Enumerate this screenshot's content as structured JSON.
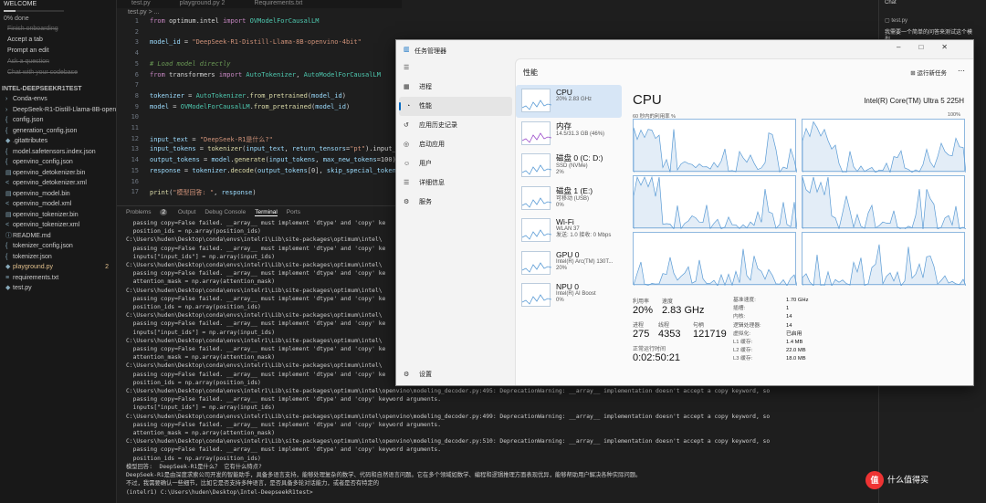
{
  "sidebar": {
    "welcome_title": "WELCOME",
    "progress_text": "0% done",
    "progress_value": 0.2,
    "walkthrough": [
      {
        "label": "Finish onboarding",
        "done": true
      },
      {
        "label": "Accept a tab",
        "done": false
      },
      {
        "label": "Prompt an edit",
        "done": false
      },
      {
        "label": "Ask a question",
        "done": true
      },
      {
        "label": "Chat with your codebase",
        "done": true
      }
    ],
    "project": "INTEL-DEEPSEEKR1TEST",
    "files": [
      {
        "name": "Conda-envs",
        "icon": "folder",
        "modified": false
      },
      {
        "name": "DeepSeek-R1-Distill-Llama-8B-open...",
        "icon": "folder",
        "modified": false
      },
      {
        "name": "config.json",
        "icon": "json",
        "modified": false
      },
      {
        "name": "generation_config.json",
        "icon": "json",
        "modified": false
      },
      {
        "name": ".gitattributes",
        "icon": "git",
        "modified": false
      },
      {
        "name": "model.safetensors.index.json",
        "icon": "json",
        "modified": false
      },
      {
        "name": "openvino_config.json",
        "icon": "json",
        "modified": false
      },
      {
        "name": "openvino_detokenizer.bin",
        "icon": "file",
        "modified": false
      },
      {
        "name": "openvino_detokenizer.xml",
        "icon": "xml",
        "modified": false
      },
      {
        "name": "openvino_model.bin",
        "icon": "file",
        "modified": false
      },
      {
        "name": "openvino_model.xml",
        "icon": "xml",
        "modified": false
      },
      {
        "name": "openvino_tokenizer.bin",
        "icon": "file",
        "modified": false
      },
      {
        "name": "openvino_tokenizer.xml",
        "icon": "xml",
        "modified": false
      },
      {
        "name": "README.md",
        "icon": "info",
        "modified": false
      },
      {
        "name": "tokenizer_config.json",
        "icon": "json",
        "modified": false
      },
      {
        "name": "tokenizer.json",
        "icon": "json",
        "modified": false
      },
      {
        "name": "playground.py",
        "icon": "py",
        "modified": true,
        "badge": "2"
      },
      {
        "name": "requirements.txt",
        "icon": "txt",
        "modified": false
      },
      {
        "name": "test.py",
        "icon": "py",
        "modified": false
      }
    ]
  },
  "editor": {
    "tabs": [
      "test.py",
      "playground.py 2",
      "Requirements.txt"
    ],
    "breadcrumb": "test.py > ...",
    "lines": [
      {
        "n": "1",
        "html": "<span class='k'>from</span> optimum.intel <span class='k'>import</span> <span class='t'>OVModelForCausalLM</span>"
      },
      {
        "n": "2",
        "html": ""
      },
      {
        "n": "3",
        "html": "<span class='v'>model_id</span> = <span class='s'>\"DeepSeek-R1-Distill-Llama-8B-openvino-4bit\"</span>"
      },
      {
        "n": "4",
        "html": ""
      },
      {
        "n": "5",
        "html": "<span class='c'># Load model directly</span>"
      },
      {
        "n": "6",
        "html": "<span class='k'>from</span> transformers <span class='k'>import</span> <span class='t'>AutoTokenizer</span>, <span class='t'>AutoModelForCausalLM</span>"
      },
      {
        "n": "7",
        "html": ""
      },
      {
        "n": "8",
        "html": "<span class='v'>tokenizer</span> = <span class='t'>AutoTokenizer</span>.<span class='f'>from_pretrained</span>(<span class='v'>model_id</span>)"
      },
      {
        "n": "9",
        "html": "<span class='v'>model</span> = <span class='t'>OVModelForCausalLM</span>.<span class='f'>from_pretrained</span>(<span class='v'>model_id</span>)"
      },
      {
        "n": "10",
        "html": ""
      },
      {
        "n": "11",
        "html": ""
      },
      {
        "n": "12",
        "html": "<span class='v'>input_text</span> = <span class='s'>\"DeepSeek-R1是什么?\"</span>"
      },
      {
        "n": "13",
        "html": "<span class='v'>input_tokens</span> = <span class='f'>tokenizer</span>(<span class='v'>input_text</span>, <span class='v'>return_tensors</span>=<span class='s'>\"pt\"</span>).input_i"
      },
      {
        "n": "14",
        "html": "<span class='v'>output_tokens</span> = <span class='v'>model</span>.<span class='f'>generate</span>(<span class='v'>input_tokens</span>, <span class='v'>max_new_tokens</span>=100)"
      },
      {
        "n": "15",
        "html": "<span class='v'>response</span> = <span class='v'>tokenizer</span>.<span class='f'>decode</span>(<span class='v'>output_tokens</span>[0], <span class='v'>skip_special_token</span>"
      },
      {
        "n": "16",
        "html": ""
      },
      {
        "n": "17",
        "html": "<span class='f'>print</span>(<span class='s'>\"模型回答: \"</span>, <span class='v'>response</span>)"
      }
    ]
  },
  "panel": {
    "tabs": [
      "Problems",
      "Output",
      "Debug Console",
      "Terminal",
      "Ports"
    ],
    "problems_count": "2",
    "active_tab": "Terminal"
  },
  "terminal": [
    "  passing copy=False failed. __array__ must implement 'dtype' and 'copy' ke",
    "  position_ids = np.array(position_ids)",
    "C:\\Users\\huden\\Desktop\\conda\\envs\\intelr1\\Lib\\site-packages\\optimum\\intel\\",
    "  passing copy=False failed. __array__ must implement 'dtype' and 'copy' ke",
    "  inputs[\"input_ids\"] = np.array(input_ids)",
    "C:\\Users\\huden\\Desktop\\conda\\envs\\intelr1\\Lib\\site-packages\\optimum\\intel\\",
    "  passing copy=False failed. __array__ must implement 'dtype' and 'copy' ke",
    "  attention_mask = np.array(attention_mask)",
    "C:\\Users\\huden\\Desktop\\conda\\envs\\intelr1\\Lib\\site-packages\\optimum\\intel\\",
    "  passing copy=False failed. __array__ must implement 'dtype' and 'copy' ke",
    "  position_ids = np.array(position_ids)",
    "C:\\Users\\huden\\Desktop\\conda\\envs\\intelr1\\Lib\\site-packages\\optimum\\intel\\",
    "  passing copy=False failed. __array__ must implement 'dtype' and 'copy' ke",
    "  inputs[\"input_ids\"] = np.array(input_ids)",
    "C:\\Users\\huden\\Desktop\\conda\\envs\\intelr1\\Lib\\site-packages\\optimum\\intel\\",
    "  passing copy=False failed. __array__ must implement 'dtype' and 'copy' ke",
    "  attention_mask = np.array(attention_mask)",
    "C:\\Users\\huden\\Desktop\\conda\\envs\\intelr1\\Lib\\site-packages\\optimum\\intel\\",
    "  passing copy=False failed. __array__ must implement 'dtype' and 'copy' ke",
    "  position_ids = np.array(position_ids)",
    "C:\\Users\\huden\\Desktop\\conda\\envs\\intelr1\\Lib\\site-packages\\optimum\\intel\\openvino\\modeling_decoder.py:495: DeprecationWarning: __array__ implementation doesn't accept a copy keyword, so",
    "  passing copy=False failed. __array__ must implement 'dtype' and 'copy' keyword arguments.",
    "  inputs[\"input_ids\"] = np.array(input_ids)",
    "C:\\Users\\huden\\Desktop\\conda\\envs\\intelr1\\Lib\\site-packages\\optimum\\intel\\openvino\\modeling_decoder.py:499: DeprecationWarning: __array__ implementation doesn't accept a copy keyword, so",
    "  passing copy=False failed. __array__ must implement 'dtype' and 'copy' keyword arguments.",
    "  attention_mask = np.array(attention_mask)",
    "C:\\Users\\huden\\Desktop\\conda\\envs\\intelr1\\Lib\\site-packages\\optimum\\intel\\openvino\\modeling_decoder.py:510: DeprecationWarning: __array__ implementation doesn't accept a copy keyword, so",
    "  passing copy=False failed. __array__ must implement 'dtype' and 'copy' keyword arguments.",
    "  position_ids = np.array(position_ids)",
    "模型回答:  DeepSeek-R1是什么？ 它有什么特点?",
    "DeepSeek-R1是由深度求索公司开发的智能助手，具备多语言支持，能够处理复杂的数学、代码和自然语言问题。它在多个领域如数学、编程和逻辑推理方面表现优异，能够帮助用户解决各种实际问题。",
    "不过，我需要确认一些细节，比如它是否支持多种语言，是否具备多轮对话能力，或者是否有特定的",
    "",
    "(intelr1) C:\\Users\\huden\\Desktop\\Intel-DeepseekR1test>"
  ],
  "taskmgr": {
    "title": "任务管理器",
    "nav": [
      {
        "label": "进程",
        "icon": "processes-icon",
        "glyph": "▦"
      },
      {
        "label": "性能",
        "icon": "performance-icon",
        "glyph": "◔",
        "selected": true
      },
      {
        "label": "应用历史记录",
        "icon": "history-icon",
        "glyph": "↺"
      },
      {
        "label": "启动应用",
        "icon": "startup-icon",
        "glyph": "◎"
      },
      {
        "label": "用户",
        "icon": "users-icon",
        "glyph": "☺"
      },
      {
        "label": "详细信息",
        "icon": "details-icon",
        "glyph": "☰"
      },
      {
        "label": "服务",
        "icon": "services-icon",
        "glyph": "⚙"
      }
    ],
    "settings": "设置",
    "header": "性能",
    "run_task": "运行新任务",
    "resources": [
      {
        "name": "CPU",
        "sub1": "20% 2.83 GHz",
        "sub2": "",
        "sub3": "",
        "selected": true
      },
      {
        "name": "内存",
        "sub1": "14.5/31.3 GB (46%)",
        "sub2": "",
        "sub3": ""
      },
      {
        "name": "磁盘 0 (C: D:)",
        "sub1": "SSD (NVMe)",
        "sub2": "2%",
        "sub3": ""
      },
      {
        "name": "磁盘 1 (E:)",
        "sub1": "可移动 (USB)",
        "sub2": "0%",
        "sub3": ""
      },
      {
        "name": "Wi-Fi",
        "sub1": "WLAN 37",
        "sub2": "发送: 1.0 接收: 0 Mbps",
        "sub3": ""
      },
      {
        "name": "GPU 0",
        "sub1": "Intel(R) Arc(TM) 130T...",
        "sub2": "20%",
        "sub3": ""
      },
      {
        "name": "NPU 0",
        "sub1": "Intel(R) AI Boost",
        "sub2": "0%",
        "sub3": ""
      }
    ],
    "cpu": {
      "title": "CPU",
      "model": "Intel(R) Core(TM) Ultra 5 225H",
      "graph_caption": "60 秒内的利用率 %",
      "graph_max": "100%",
      "utilization_label": "利用率",
      "utilization": "20%",
      "speed_label": "速度",
      "speed": "2.83 GHz",
      "processes_label": "进程",
      "processes": "275",
      "threads_label": "线程",
      "threads": "4353",
      "handles_label": "句柄",
      "handles": "121719",
      "uptime_label": "正常运行时间",
      "uptime": "0:02:50:21",
      "specs": [
        {
          "k": "基准速度:",
          "v": "1.70 GHz"
        },
        {
          "k": "插槽:",
          "v": "1"
        },
        {
          "k": "内核:",
          "v": "14"
        },
        {
          "k": "逻辑处理器:",
          "v": "14"
        },
        {
          "k": "虚拟化:",
          "v": "已启用"
        },
        {
          "k": "L1 缓存:",
          "v": "1.4 MB"
        },
        {
          "k": "L2 缓存:",
          "v": "22.0 MB"
        },
        {
          "k": "L3 缓存:",
          "v": "18.0 MB"
        }
      ]
    }
  },
  "chat": {
    "title": "Chat",
    "file": "test.py",
    "question": "我需要一个简单的问答来测试这个模型，"
  },
  "watermark": {
    "logo": "值",
    "text": "什么值得买"
  }
}
